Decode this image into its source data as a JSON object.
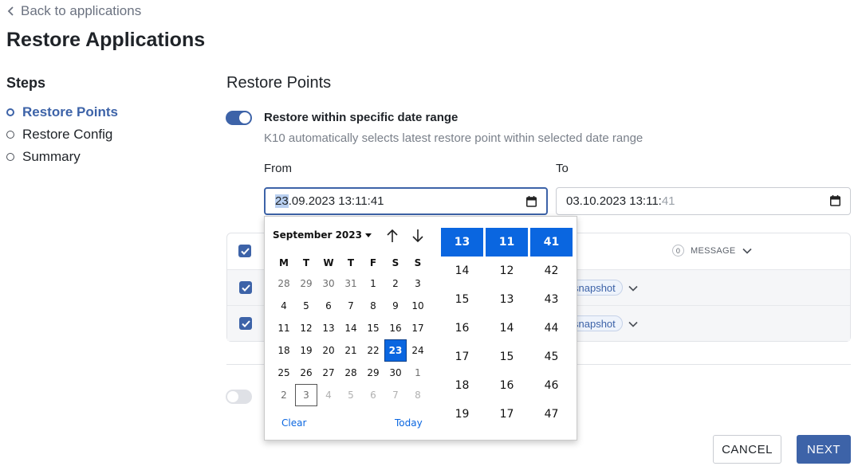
{
  "header": {
    "back_label": "Back to applications",
    "title": "Restore Applications"
  },
  "steps": {
    "title": "Steps",
    "items": [
      {
        "label": "Restore Points",
        "active": true
      },
      {
        "label": "Restore Config",
        "active": false
      },
      {
        "label": "Summary",
        "active": false
      }
    ]
  },
  "main": {
    "section_title": "Restore Points",
    "date_range_toggle": {
      "label": "Restore within specific date range",
      "on": true
    },
    "helper_text": "K10 automatically selects latest restore point within selected date range",
    "from": {
      "label": "From",
      "value_highlight": "23",
      "value_rest": ".09.2023 13:11:41"
    },
    "to": {
      "label": "To",
      "value_main": "03.10.2023 13:11:",
      "value_dim": "41"
    },
    "table": {
      "message_count": "0",
      "message_header": "MESSAGE",
      "rows": [
        {
          "tag": "snapshot",
          "checked": true
        },
        {
          "tag": "snapshot",
          "checked": true
        }
      ]
    },
    "second_toggle": {
      "on": false
    }
  },
  "picker": {
    "month_label": "September 2023",
    "weekdays": [
      "M",
      "T",
      "W",
      "T",
      "F",
      "S",
      "S"
    ],
    "weeks": [
      [
        "28",
        "29",
        "30",
        "31",
        "1",
        "2",
        "3"
      ],
      [
        "4",
        "5",
        "6",
        "7",
        "8",
        "9",
        "10"
      ],
      [
        "11",
        "12",
        "13",
        "14",
        "15",
        "16",
        "17"
      ],
      [
        "18",
        "19",
        "20",
        "21",
        "22",
        "23",
        "24"
      ],
      [
        "25",
        "26",
        "27",
        "28",
        "29",
        "30",
        "1"
      ],
      [
        "2",
        "3",
        "4",
        "5",
        "6",
        "7",
        "8"
      ]
    ],
    "selected_day": "23",
    "today_day": "3",
    "clear_label": "Clear",
    "today_label": "Today",
    "hours": [
      "13",
      "14",
      "15",
      "16",
      "17",
      "18",
      "19"
    ],
    "minutes": [
      "11",
      "12",
      "13",
      "14",
      "15",
      "16",
      "17"
    ],
    "seconds": [
      "41",
      "42",
      "43",
      "44",
      "45",
      "46",
      "47"
    ]
  },
  "footer": {
    "cancel_label": "CANCEL",
    "next_label": "NEXT"
  },
  "colors": {
    "accent": "#3d63a8",
    "picker_selected": "#0a66e0"
  }
}
